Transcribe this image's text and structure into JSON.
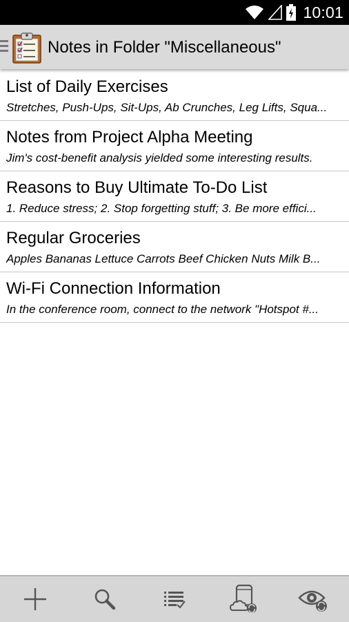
{
  "status_bar": {
    "time": "10:01",
    "icons": [
      "wifi-icon",
      "cell-signal-icon",
      "battery-charging-icon"
    ]
  },
  "action_bar": {
    "title": "Notes in Folder \"Miscellaneous\"",
    "icons": [
      "drawer-indicator-icon",
      "clipboard-checklist-icon"
    ]
  },
  "notes": [
    {
      "title": "List of Daily Exercises",
      "preview": "Stretches, Push-Ups, Sit-Ups, Ab Crunches, Leg Lifts, Squa..."
    },
    {
      "title": "Notes from Project Alpha Meeting",
      "preview": "Jim's cost-benefit analysis yielded some interesting results."
    },
    {
      "title": "Reasons to Buy Ultimate To-Do List",
      "preview": "1. Reduce stress; 2. Stop forgetting stuff; 3. Be more effici..."
    },
    {
      "title": "Regular Groceries",
      "preview": "Apples Bananas Lettuce Carrots Beef Chicken Nuts Milk B..."
    },
    {
      "title": "Wi-Fi Connection Information",
      "preview": "In the conference room, connect to the network \"Hotspot #..."
    }
  ],
  "bottom_bar": {
    "buttons": [
      "add-icon",
      "search-icon",
      "list-sort-icon",
      "sync-device-icon",
      "visibility-sync-icon"
    ]
  },
  "colors": {
    "status_bar_bg": "#000000",
    "action_bar_bg": "#dadada",
    "bottom_bar_bg": "#d6d6d6",
    "divider": "#c8c8c8",
    "icon_gray": "#555555"
  }
}
